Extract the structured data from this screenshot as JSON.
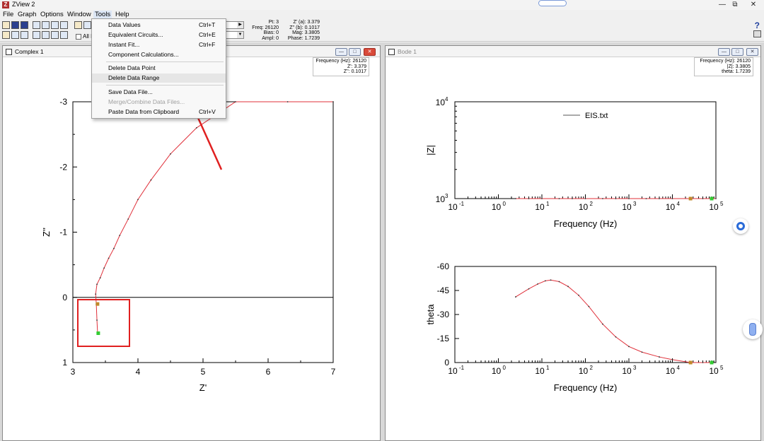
{
  "window": {
    "title": "ZView 2",
    "logo_letter": "Z",
    "controls": [
      "—",
      "⧉",
      "✕"
    ]
  },
  "menubar": {
    "items": [
      "File",
      "Graph",
      "Options",
      "Window",
      "Tools",
      "Help"
    ]
  },
  "toolbar": {
    "checkbox_label": "All F",
    "help_symbol": "?",
    "status": {
      "pt": "Pt: 3",
      "freq": "Freq: 26120",
      "bias": "Bias: 0",
      "ampl": "Ampl: 0",
      "za": "Z' (a): 3.379",
      "zb": "Z'' (b): 0.1017",
      "mag": "Mag: 3.3805",
      "phase": "Phase: 1.7239"
    }
  },
  "tools_menu": {
    "items": [
      {
        "label": "Data Values",
        "shortcut": "Ctrl+T",
        "enabled": true
      },
      {
        "label": "Equivalent Circuits...",
        "shortcut": "Ctrl+E",
        "enabled": true
      },
      {
        "label": "Instant Fit...",
        "shortcut": "Ctrl+F",
        "enabled": true
      },
      {
        "label": "Component Calculations...",
        "shortcut": "",
        "enabled": true
      },
      {
        "label": "Delete Data Point",
        "shortcut": "",
        "enabled": true
      },
      {
        "label": "Delete Data Range",
        "shortcut": "",
        "enabled": true,
        "highlighted": true
      },
      {
        "label": "Save Data File...",
        "shortcut": "",
        "enabled": true
      },
      {
        "label": "Merge/Combine Data Files...",
        "shortcut": "",
        "enabled": false
      },
      {
        "label": "Paste Data from Clipboard",
        "shortcut": "Ctrl+V",
        "enabled": true
      }
    ]
  },
  "complex_panel": {
    "title": "Complex 1",
    "info": {
      "line1": "Frequency (Hz): 26120",
      "line2": "Z': 3.379",
      "line3": "Z'': 0.1017"
    },
    "chart_data": {
      "type": "line",
      "xlabel": "Z'",
      "ylabel": "Z''",
      "xlim": [
        3,
        7
      ],
      "ylim": [
        -3,
        1
      ],
      "y_inverted": true,
      "x_ticks": [
        "3",
        "4",
        "5",
        "6",
        "7"
      ],
      "y_ticks": [
        "-3",
        "-2",
        "-1",
        "0",
        "1"
      ],
      "series": [
        {
          "color": "#e0303a",
          "x": [
            3.38,
            3.37,
            3.36,
            3.35,
            3.37,
            3.42,
            3.48,
            3.55,
            3.63,
            3.72,
            3.85,
            4.0,
            4.2,
            4.5,
            4.9,
            5.5,
            6.3,
            7.0
          ],
          "y": [
            0.55,
            0.35,
            0.1017,
            -0.05,
            -0.2,
            -0.3,
            -0.45,
            -0.6,
            -0.75,
            -0.95,
            -1.2,
            -1.5,
            -1.8,
            -2.2,
            -2.6,
            -3.0,
            -3.0,
            -3.0
          ]
        }
      ],
      "markers": [
        {
          "x": 3.379,
          "y": 0.1017,
          "color": "#c0882a"
        },
        {
          "x": 3.39,
          "y": 0.55,
          "color": "#33cc33"
        }
      ],
      "grid": false
    }
  },
  "bode_panel": {
    "title": "Bode 1",
    "info": {
      "line1": "Frequency (Hz): 26120",
      "line2": "|Z|: 3.3805",
      "line3": "theta: 1.7239"
    },
    "mag_chart": {
      "type": "line",
      "xlabel": "Frequency (Hz)",
      "ylabel": "|Z|",
      "x_log": true,
      "y_log": true,
      "xlim": [
        0.1,
        100000
      ],
      "ylim": [
        1000,
        10000
      ],
      "x_ticks": [
        "10",
        "10",
        "10",
        "10",
        "10",
        "10",
        "10"
      ],
      "x_exps": [
        "-1",
        "0",
        "1",
        "2",
        "3",
        "4",
        "5"
      ],
      "y_ticks": [
        "10",
        "10"
      ],
      "y_exps": [
        "3",
        "4"
      ],
      "legend": {
        "label": "EIS.txt",
        "placement": "top-center"
      },
      "series": [
        {
          "name": "EIS.txt",
          "color": "#e0303a",
          "x": [
            2.5,
            5,
            10,
            25,
            50,
            100,
            250,
            500,
            1000,
            2500,
            5000,
            10000,
            26120,
            50000,
            80000,
            100000
          ],
          "y": [
            1000,
            1000,
            1000,
            1000,
            1000,
            1000,
            1000,
            1000,
            1000,
            1000,
            1000,
            1000,
            1000,
            1000,
            1000,
            1000
          ]
        }
      ],
      "markers": [
        {
          "x": 26120,
          "y": 1000,
          "color": "#c0882a"
        },
        {
          "x": 80000,
          "y": 1000,
          "color": "#33cc33"
        }
      ]
    },
    "phase_chart": {
      "type": "line",
      "xlabel": "Frequency (Hz)",
      "ylabel": "theta",
      "x_log": true,
      "xlim": [
        0.1,
        100000
      ],
      "ylim": [
        -60,
        0
      ],
      "y_inverted": true,
      "x_ticks": [
        "10",
        "10",
        "10",
        "10",
        "10",
        "10",
        "10"
      ],
      "x_exps": [
        "-1",
        "0",
        "1",
        "2",
        "3",
        "4",
        "5"
      ],
      "y_ticks": [
        "-60",
        "-45",
        "-30",
        "-15",
        "0"
      ],
      "series": [
        {
          "color": "#e0303a",
          "x": [
            2.5,
            5,
            8,
            12,
            16,
            25,
            40,
            70,
            120,
            250,
            500,
            1000,
            2000,
            5000,
            10000,
            26120,
            50000,
            80000
          ],
          "y": [
            -41,
            -46,
            -49,
            -51,
            -51.5,
            -50.5,
            -47.5,
            -42,
            -35,
            -24,
            -16,
            -10,
            -6.5,
            -3.5,
            -1.8,
            0,
            0,
            0
          ]
        }
      ],
      "markers": [
        {
          "x": 26120,
          "y": 0,
          "color": "#c0882a"
        },
        {
          "x": 80000,
          "y": 0,
          "color": "#33cc33"
        }
      ]
    }
  }
}
